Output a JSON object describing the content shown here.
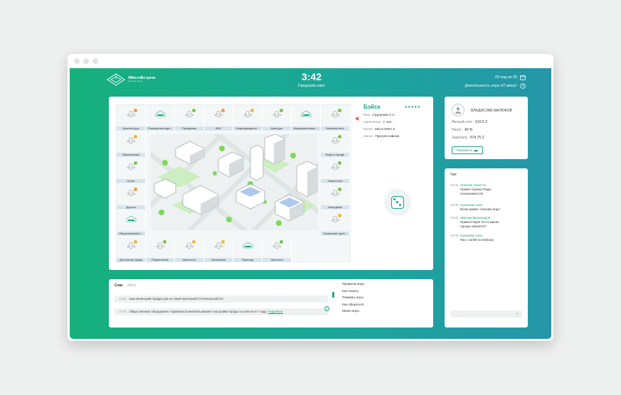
{
  "header": {
    "logo_title": "#МестоВстречи",
    "logo_sub": "игра про город",
    "timer": "3:42",
    "phase": "Городской совет",
    "turn": "20 ход из 25",
    "duration": "Длительность игры 47 минут"
  },
  "cells": [
    {
      "label": "Архитектура",
      "badge": "#f09a3e"
    },
    {
      "label": "Помещения адм...",
      "badge": ""
    },
    {
      "label": "Праздники",
      "badge": "#7cc24a"
    },
    {
      "label": "ЖКХ",
      "badge": "#f09a3e"
    },
    {
      "label": "Информационн...",
      "badge": "#f0b73e"
    },
    {
      "label": "Культура",
      "badge": "#7cc24a"
    },
    {
      "label": "Муниципальные ...",
      "badge": ""
    },
    {
      "label": "Безопасность",
      "badge": "#7cc24a"
    },
    {
      "label": "Образование",
      "badge": "#f0b73e"
    },
    {
      "label": "Вода в городе",
      "badge": "#7cc24a"
    },
    {
      "label": "Спорт",
      "badge": "#7cc24a"
    },
    {
      "label": "Творчество",
      "badge": "#7cc24a"
    },
    {
      "label": "Дороги",
      "badge": "#f09a3e"
    },
    {
      "label": "Молодёжь",
      "badge": "#7cc24a"
    },
    {
      "label": "Общественный т...",
      "badge": ""
    },
    {
      "label": "Локальные проб...",
      "badge": "#f0b73e"
    },
    {
      "label": "Доступная среда",
      "badge": "#f0b73e"
    },
    {
      "label": "Развлечение",
      "badge": "#7cc24a"
    },
    {
      "label": "Занятость",
      "badge": "#f0b73e"
    },
    {
      "label": "Экономика",
      "badge": "#f0b73e"
    },
    {
      "label": "Переезд",
      "badge": ""
    },
    {
      "label": "Экология",
      "badge": "#7cc24a"
    }
  ],
  "city": {
    "name": "Бэйск",
    "stars": "★★★★★",
    "rows": [
      {
        "k": "Мэр",
        "v": "Сидорова С.С."
      },
      {
        "k": "Население",
        "v": "1 чел."
      },
      {
        "k": "Казна",
        "v": "564,5 МЛН Z"
      },
      {
        "k": "Налог",
        "v": "Прогрессивная"
      }
    ]
  },
  "user": {
    "name": "ВЛАДИСЛАВ МАЛЮКОВ",
    "rows": [
      {
        "k": "Личный счет",
        "v": "615.5 Z"
      },
      {
        "k": "Налог",
        "v": "40 %"
      },
      {
        "k": "Зарплата",
        "v": "574.75 Z"
      }
    ],
    "transfer": "Перевести"
  },
  "chat": {
    "title": "Чат",
    "messages": [
      {
        "time": "19:08",
        "author": "Неектан Тюнетта",
        "text": "Привет игроки! Рада познакомиться!"
      },
      {
        "time": "19:08",
        "author": "Куликова Анна",
        "text": "Всем привет. Начнем игру!"
      },
      {
        "time": "19:08",
        "author": "Максим Виноградов",
        "text": "Приветствую! Кто в каком городе оказался?"
      },
      {
        "time": "19:08",
        "author": "Куликова Анна",
        "text": "Мы с колей из Бэйска)"
      }
    ],
    "send_icon": "arrow-right-icon"
  },
  "news": {
    "tab_active": "Сми",
    "tab_other": "Айсэ",
    "items": [
      {
        "time": "19:08",
        "text": "Наш маленький городок уже не такой маленький! Отличная работа!",
        "link": ""
      },
      {
        "time": "19:08",
        "text": "Общественные обсуждения о правилах вопелительования и застройки города состоятся на 7 ходу.",
        "link": "Подробнее"
      }
    ],
    "links": [
      "Правила игры",
      "Как играть",
      "Помимо игры",
      "Как общаться",
      "Мини игры"
    ]
  },
  "colors": {
    "accent": "#1ba57d",
    "grad_start": "#16b07c",
    "grad_end": "#2696a9"
  }
}
